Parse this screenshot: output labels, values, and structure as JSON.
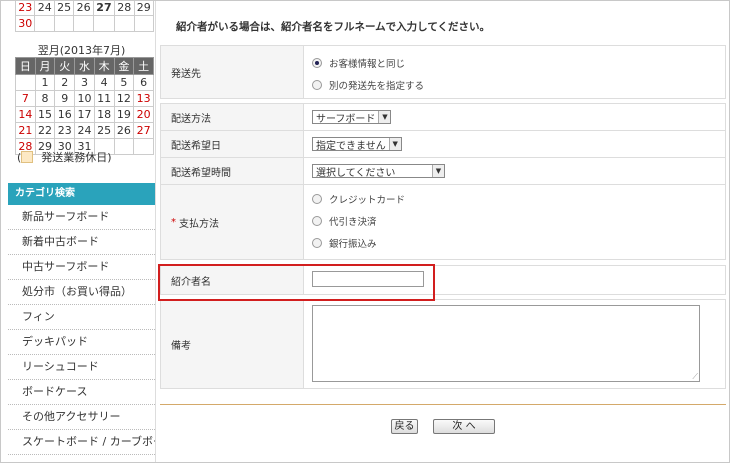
{
  "calendar": {
    "prev_rows": [
      [
        {
          "d": "23",
          "sun": true
        },
        {
          "d": "24"
        },
        {
          "d": "25"
        },
        {
          "d": "26"
        },
        {
          "d": "27",
          "today": true
        },
        {
          "d": "28"
        },
        {
          "d": "29"
        }
      ],
      [
        {
          "d": "30",
          "sun": true
        },
        {
          "d": ""
        },
        {
          "d": ""
        },
        {
          "d": ""
        },
        {
          "d": ""
        },
        {
          "d": ""
        },
        {
          "d": ""
        }
      ]
    ],
    "next_title": "翌月(2013年7月)",
    "weekdays": [
      "日",
      "月",
      "火",
      "水",
      "木",
      "金",
      "土"
    ],
    "rows": [
      [
        {
          "d": ""
        },
        {
          "d": "1"
        },
        {
          "d": "2"
        },
        {
          "d": "3"
        },
        {
          "d": "4"
        },
        {
          "d": "5"
        },
        {
          "d": "6"
        }
      ],
      [
        {
          "d": "7",
          "sun": true
        },
        {
          "d": "8"
        },
        {
          "d": "9"
        },
        {
          "d": "10"
        },
        {
          "d": "11"
        },
        {
          "d": "12"
        },
        {
          "d": "13",
          "sun": true
        }
      ],
      [
        {
          "d": "14",
          "sun": true
        },
        {
          "d": "15"
        },
        {
          "d": "16"
        },
        {
          "d": "17"
        },
        {
          "d": "18"
        },
        {
          "d": "19"
        },
        {
          "d": "20",
          "sun": true
        }
      ],
      [
        {
          "d": "21",
          "sun": true
        },
        {
          "d": "22"
        },
        {
          "d": "23"
        },
        {
          "d": "24"
        },
        {
          "d": "25"
        },
        {
          "d": "26"
        },
        {
          "d": "27",
          "sun": true
        }
      ],
      [
        {
          "d": "28",
          "sun": true
        },
        {
          "d": "29"
        },
        {
          "d": "30"
        },
        {
          "d": "31"
        },
        {
          "d": ""
        },
        {
          "d": ""
        },
        {
          "d": ""
        }
      ]
    ],
    "legend": "発送業務休日)",
    "legend_prefix": "(",
    "legend_color": "#fde9c4"
  },
  "category": {
    "heading": "カテゴリ検索",
    "items": [
      "新品サーフボード",
      "新着中古ボード",
      "中古サーフボード",
      "処分市（お買い得品）",
      "フィン",
      "デッキパッド",
      "リーシュコード",
      "ボードケース",
      "その他アクセサリー",
      "スケートボード / カーブボード"
    ]
  },
  "notice": "紹介者がいる場合は、紹介者名をフルネームで入力してください。",
  "form": {
    "shipping_label": "発送先",
    "shipping_options": [
      {
        "label": "お客様情報と同じ",
        "checked": true
      },
      {
        "label": "別の発送先を指定する",
        "checked": false
      }
    ],
    "delivery_method_label": "配送方法",
    "delivery_method_value": "サーフボード",
    "delivery_date_label": "配送希望日",
    "delivery_date_value": "指定できません",
    "delivery_time_label": "配送希望時間",
    "delivery_time_value": "選択してください",
    "payment_label": "支払方法",
    "payment_required_mark": "*",
    "payment_options": [
      {
        "label": "クレジットカード",
        "checked": false
      },
      {
        "label": "代引き決済",
        "checked": false
      },
      {
        "label": "銀行振込み",
        "checked": false
      }
    ],
    "referrer_label": "紹介者名",
    "referrer_value": "",
    "notes_label": "備考",
    "notes_value": ""
  },
  "buttons": {
    "back": "戻る",
    "next": "次 へ"
  },
  "colors": {
    "category_header": "#2aa3bb",
    "highlight_border": "#d21e1e",
    "sunday": "#cc0000"
  }
}
